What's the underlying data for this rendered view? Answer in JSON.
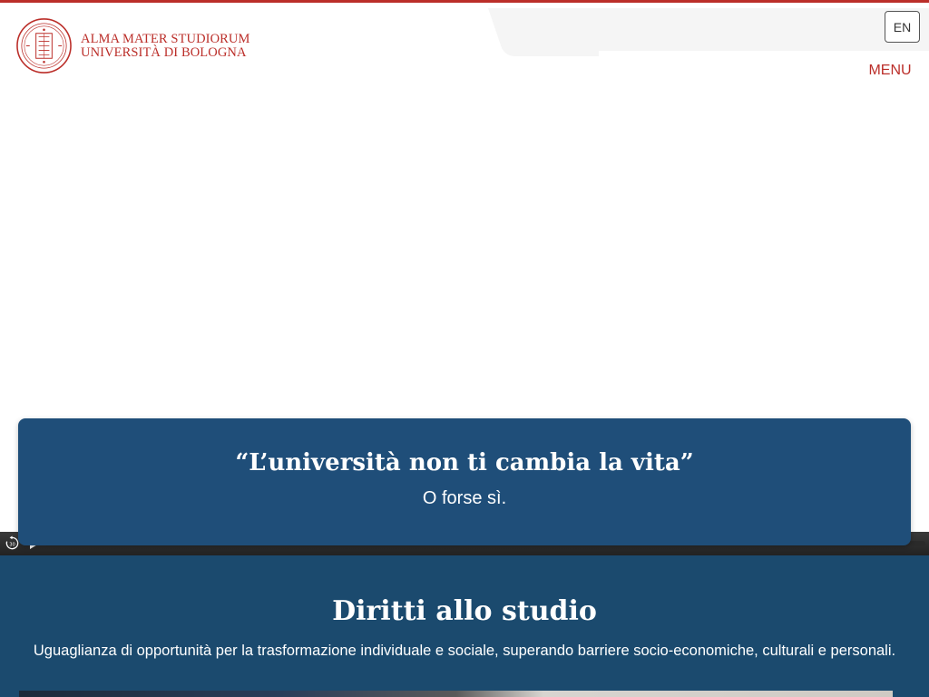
{
  "header": {
    "logo_line1": "ALMA MATER STUDIORUM",
    "logo_line2": "UNIVERSITÀ DI BOLOGNA",
    "lang_label": "EN",
    "menu_label": "MENU"
  },
  "hero": {
    "quote_title": "“L’università non ti cambia la vita”",
    "quote_subtitle": "O forse sì."
  },
  "video": {
    "replay_icon": "replay-30-icon",
    "play_icon": "play-icon"
  },
  "rights": {
    "title": "Diritti allo studio",
    "description": "Uguaglianza di opportunità per la trasformazione individuale e sociale, superando barriere socio-economiche, culturali e personali."
  },
  "colors": {
    "brand_red": "#bb2e29",
    "quote_blue": "#1f4e79",
    "section_blue": "#1b4a6e"
  }
}
